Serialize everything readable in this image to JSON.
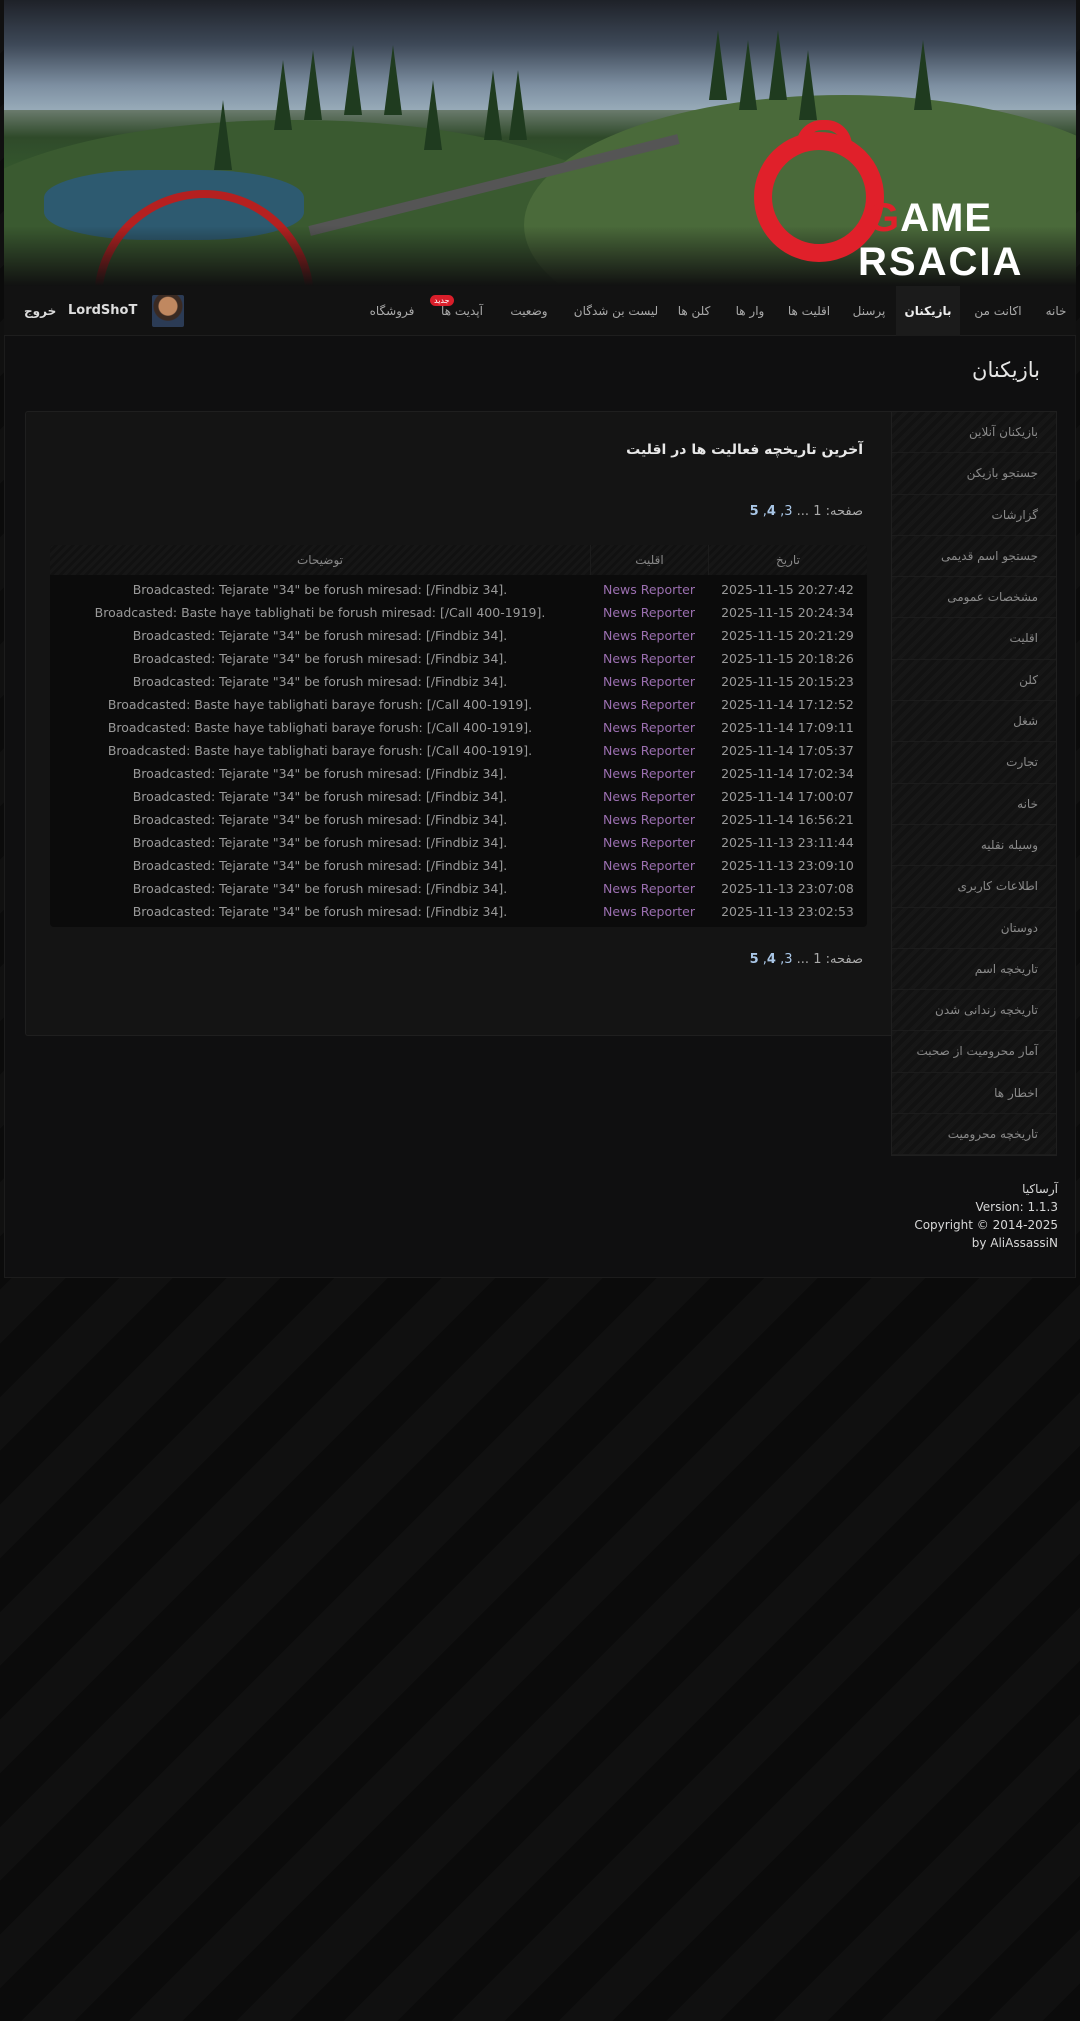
{
  "brand": {
    "logo_line1_red": "G",
    "logo_line1": "AME",
    "logo_line2": "RSACIA"
  },
  "nav": {
    "items": [
      {
        "label": "خانه"
      },
      {
        "label": "اکانت من"
      },
      {
        "label": "بازیکنان",
        "active": true
      },
      {
        "label": "پرسنل"
      },
      {
        "label": "اقلیت ها"
      },
      {
        "label": "وار ها"
      },
      {
        "label": "کلن ها"
      },
      {
        "label": "لیست بن شدگان"
      },
      {
        "label": "وضعیت"
      },
      {
        "label": "آپدیت ها",
        "badge": "جدید"
      },
      {
        "label": "فروشگاه"
      }
    ],
    "user_name": "LordShoT",
    "logout_label": "خروج"
  },
  "page_title": "بازیکنان",
  "sidebar": {
    "items": [
      "بازیکنان آنلاین",
      "جستجو بازیکن",
      "گزارشات",
      "جستجو اسم قدیمی",
      "مشخصات عمومی",
      "اقلیت",
      "کلن",
      "شغل",
      "تجارت",
      "خانه",
      "وسیله نقلیه",
      "اطلاعات کاربری",
      "دوستان",
      "تاریخچه اسم",
      "تاریخچه زندانی شدن",
      "آمار محرومیت از صحبت",
      "اخطار ها",
      "تاریخچه محرومیت"
    ]
  },
  "panel": {
    "title": "آخرین تاریخچه فعالیت ها در اقلیت",
    "pager_label": "صفحه:",
    "pages": [
      "1",
      "...",
      "3",
      "4",
      "5"
    ],
    "pager_text_full": "صفحه: 1 ... 3, 4, 5"
  },
  "table": {
    "headers": {
      "date": "تاریخ",
      "faction": "اقلیت",
      "desc": "توضیحات"
    },
    "rows": [
      {
        "date": "2025-11-15 20:27:42",
        "faction": "News Reporter",
        "desc": "Broadcasted: Tejarate \"34\" be forush miresad: [/Findbiz 34]."
      },
      {
        "date": "2025-11-15 20:24:34",
        "faction": "News Reporter",
        "desc": "Broadcasted: Baste haye tablighati be forush miresad: [/Call 400-1919]."
      },
      {
        "date": "2025-11-15 20:21:29",
        "faction": "News Reporter",
        "desc": "Broadcasted: Tejarate \"34\" be forush miresad: [/Findbiz 34]."
      },
      {
        "date": "2025-11-15 20:18:26",
        "faction": "News Reporter",
        "desc": "Broadcasted: Tejarate \"34\" be forush miresad: [/Findbiz 34]."
      },
      {
        "date": "2025-11-15 20:15:23",
        "faction": "News Reporter",
        "desc": "Broadcasted: Tejarate \"34\" be forush miresad: [/Findbiz 34]."
      },
      {
        "date": "2025-11-14 17:12:52",
        "faction": "News Reporter",
        "desc": "Broadcasted: Baste haye tablighati baraye forush: [/Call 400-1919]."
      },
      {
        "date": "2025-11-14 17:09:11",
        "faction": "News Reporter",
        "desc": "Broadcasted: Baste haye tablighati baraye forush: [/Call 400-1919]."
      },
      {
        "date": "2025-11-14 17:05:37",
        "faction": "News Reporter",
        "desc": "Broadcasted: Baste haye tablighati baraye forush: [/Call 400-1919]."
      },
      {
        "date": "2025-11-14 17:02:34",
        "faction": "News Reporter",
        "desc": "Broadcasted: Tejarate \"34\" be forush miresad: [/Findbiz 34]."
      },
      {
        "date": "2025-11-14 17:00:07",
        "faction": "News Reporter",
        "desc": "Broadcasted: Tejarate \"34\" be forush miresad: [/Findbiz 34]."
      },
      {
        "date": "2025-11-14 16:56:21",
        "faction": "News Reporter",
        "desc": "Broadcasted: Tejarate \"34\" be forush miresad: [/Findbiz 34]."
      },
      {
        "date": "2025-11-13 23:11:44",
        "faction": "News Reporter",
        "desc": "Broadcasted: Tejarate \"34\" be forush miresad: [/Findbiz 34]."
      },
      {
        "date": "2025-11-13 23:09:10",
        "faction": "News Reporter",
        "desc": "Broadcasted: Tejarate \"34\" be forush miresad: [/Findbiz 34]."
      },
      {
        "date": "2025-11-13 23:07:08",
        "faction": "News Reporter",
        "desc": "Broadcasted: Tejarate \"34\" be forush miresad: [/Findbiz 34]."
      },
      {
        "date": "2025-11-13 23:02:53",
        "faction": "News Reporter",
        "desc": "Broadcasted: Tejarate \"34\" be forush miresad: [/Findbiz 34]."
      }
    ]
  },
  "footer": {
    "line1": "آرساکیا",
    "line2": "Version: 1.1.3",
    "line3": "Copyright © 2014-2025",
    "line4": "by AliAssassiN"
  },
  "colors": {
    "accent_red": "#e0202a",
    "faction_purple": "#9b6fb0",
    "page_link": "#a9c6e6"
  }
}
